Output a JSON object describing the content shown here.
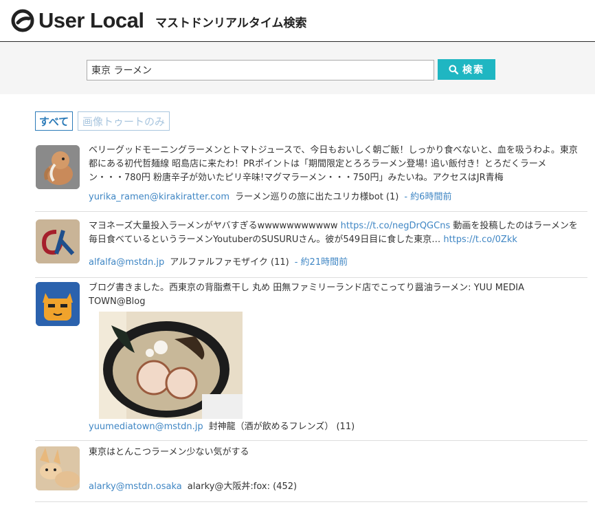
{
  "header": {
    "logo_text": "User Local",
    "title": "マストドンリアルタイム検索"
  },
  "search": {
    "value": "東京 ラーメン",
    "button_label": "検索"
  },
  "filters": {
    "all_label": "すべて",
    "images_only_label": "画像トゥートのみ"
  },
  "colors": {
    "accent": "#1fb6c2",
    "link": "#3f86c4"
  },
  "toots": [
    {
      "avatar_icon": "mammoth-icon",
      "text": "ベリーグッドモーニングラーメンとトマトジュースで、今日もおいしく朝ご飯！しっかり食べないと、血を吸うわよ。東京都にある初代哲麺線 昭島店に来たわ！PRポイントは「期間限定とろろラーメン登場! 追い飯付き！とろだくラーメン・・・780円 粉唐辛子が効いたピリ辛味!マグマラーメン・・・750円」みたいね。アクセスはJR青梅",
      "account": "yurika_ramen@kirakiratter.com",
      "display_name": "ラーメン巡りの旅に出たユリカ様bot (1)",
      "time": "- 約6時間前"
    },
    {
      "avatar_icon": "alfalfa-logo-icon",
      "text_before": "マヨネーズ大量投入ラーメンがヤバすぎるwwwwwwwwwww ",
      "link1": "https://t.co/negDrQGCns",
      "text_middle": " 動画を投稿したのはラーメンを毎日食べているというラーメンYoutuberのSUSURUさん。彼が549日目に食した東京… ",
      "link2": "https://t.co/0Zkk",
      "account": "alfalfa@mstdn.jp",
      "display_name": "アルファルファモザイク (11)",
      "time": "- 約21時間前"
    },
    {
      "avatar_icon": "cat-icon",
      "text": "ブログ書きました。西東京の背脂煮干し 丸め 田無ファミリーランド店でこってり醤油ラーメン: YUU MEDIA TOWN@Blog",
      "media_icon": "ramen-photo",
      "account": "yuumediatown@mstdn.jp",
      "display_name": "封神龍（酒が飲めるフレンズ） (11)",
      "time": ""
    },
    {
      "avatar_icon": "fox-icon",
      "text": "東京はとんこつラーメン少ない気がする",
      "account": "alarky@mstdn.osaka",
      "display_name": "alarky@大阪丼:fox: (452)",
      "time": ""
    }
  ]
}
